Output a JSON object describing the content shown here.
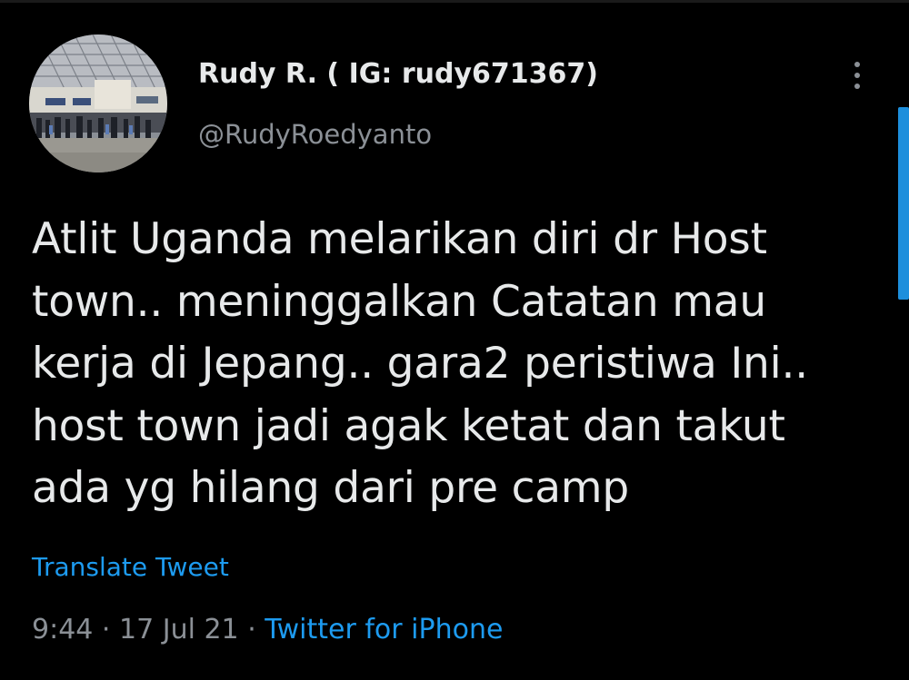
{
  "tweet": {
    "author": {
      "display_name": "Rudy R. ( IG: rudy671367)",
      "handle": "@RudyRoedyanto"
    },
    "text": "Atlit Uganda melarikan diri dr Host\ntown.. meninggalkan Catatan mau\nkerja di Jepang.. gara2 peristiwa Ini..\nhost town jadi agak ketat dan takut\nada yg hilang dari pre camp",
    "translate_label": "Translate Tweet",
    "time": "9:44",
    "separator_1": "·",
    "date": "17 Jul 21",
    "separator_2": "·",
    "source": "Twitter for iPhone"
  },
  "icons": {
    "more": "more-vertical-icon",
    "avatar": "avatar-airport-photo"
  },
  "colors": {
    "background": "#000000",
    "primary_text": "#e7e9ea",
    "secondary_text": "#8b9096",
    "link": "#1d9bf0",
    "scroll_thumb": "#1d8fdc"
  }
}
